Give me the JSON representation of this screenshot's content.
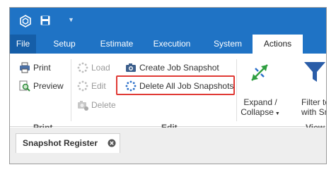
{
  "tabs": {
    "file": "File",
    "setup": "Setup",
    "estimate": "Estimate",
    "execution": "Execution",
    "system": "System",
    "actions": "Actions"
  },
  "groups": {
    "print": {
      "label": "Print",
      "print_button": "Print",
      "preview_button": "Preview"
    },
    "edit": {
      "label": "Edit",
      "load_button": "Load",
      "edit_button": "Edit",
      "delete_button": "Delete",
      "create_snapshot_button": "Create Job Snapshot",
      "delete_all_button": "Delete All Job Snapshots"
    },
    "view": {
      "label": "View",
      "expand_collapse_line1": "Expand /",
      "expand_collapse_line2": "Collapse",
      "filter_line1": "Filter to",
      "filter_line2": "with Sna"
    }
  },
  "document_tab": {
    "label": "Snapshot Register"
  },
  "colors": {
    "ribbon_blue": "#1f73c5",
    "highlight_red": "#e03a35"
  }
}
